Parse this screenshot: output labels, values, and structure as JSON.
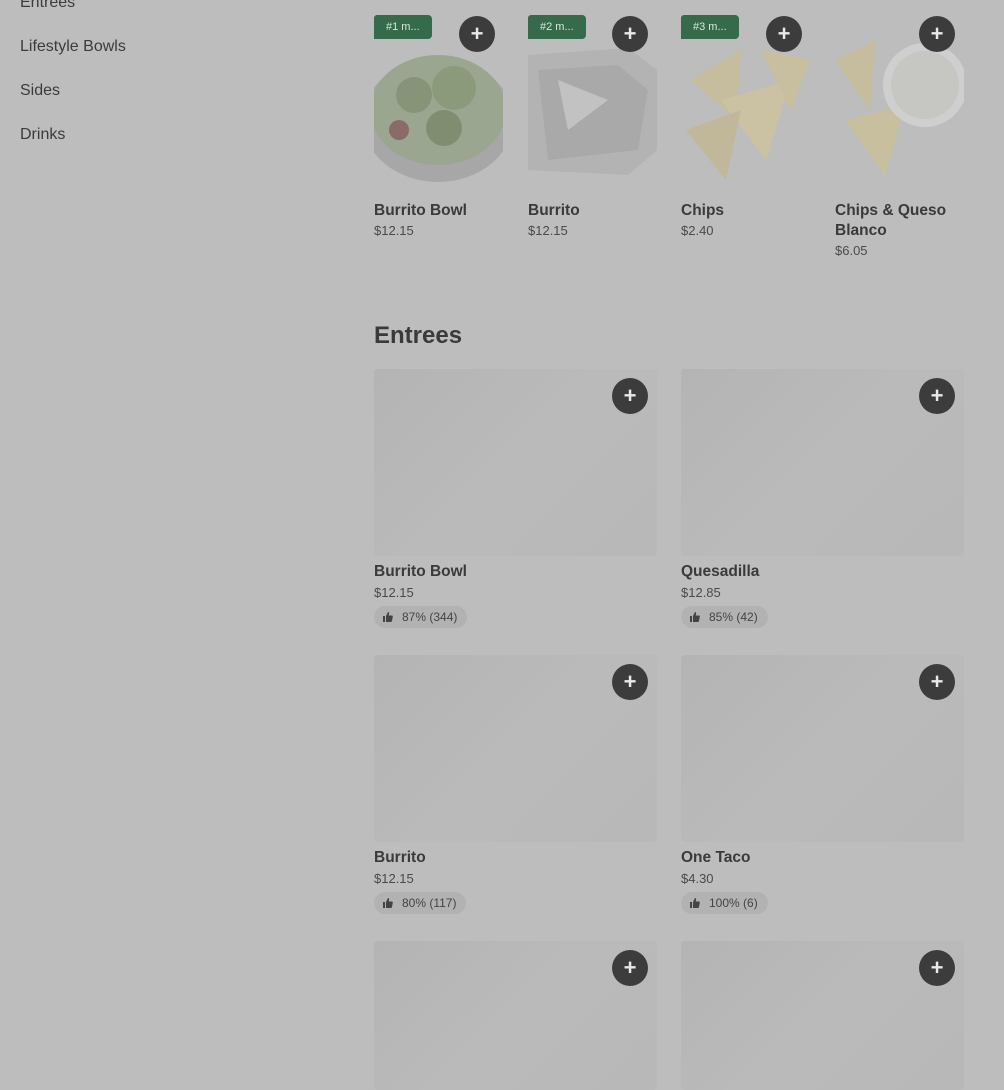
{
  "sidebar": {
    "items": [
      "Entrees",
      "Lifestyle Bowls",
      "Sides",
      "Drinks"
    ]
  },
  "popular": {
    "items": [
      {
        "badge": "#1 m...",
        "name": "Burrito Bowl",
        "price": "$12.15"
      },
      {
        "badge": "#2 m...",
        "name": "Burrito",
        "price": "$12.15"
      },
      {
        "badge": "#3 m...",
        "name": "Chips",
        "price": "$2.40"
      },
      {
        "badge": "",
        "name": "Chips & Queso Blanco",
        "price": "$6.05"
      }
    ]
  },
  "entrees": {
    "title": "Entrees",
    "items": [
      {
        "name": "Burrito Bowl",
        "price": "$12.15",
        "rating": "87% (344)"
      },
      {
        "name": "Quesadilla",
        "price": "$12.85",
        "rating": "85% (42)"
      },
      {
        "name": "Burrito",
        "price": "$12.15",
        "rating": "80% (117)"
      },
      {
        "name": "One Taco",
        "price": "$4.30",
        "rating": "100% (6)"
      },
      {
        "name": "",
        "price": "",
        "rating": ""
      },
      {
        "name": "",
        "price": "",
        "rating": ""
      }
    ]
  },
  "icons": {
    "add": "plus-icon",
    "rating": "thumbs-up-icon"
  },
  "colors": {
    "badge": "#356a4a",
    "add_button": "#3c3c3c",
    "overlay_bg": "#bdbdbd"
  }
}
